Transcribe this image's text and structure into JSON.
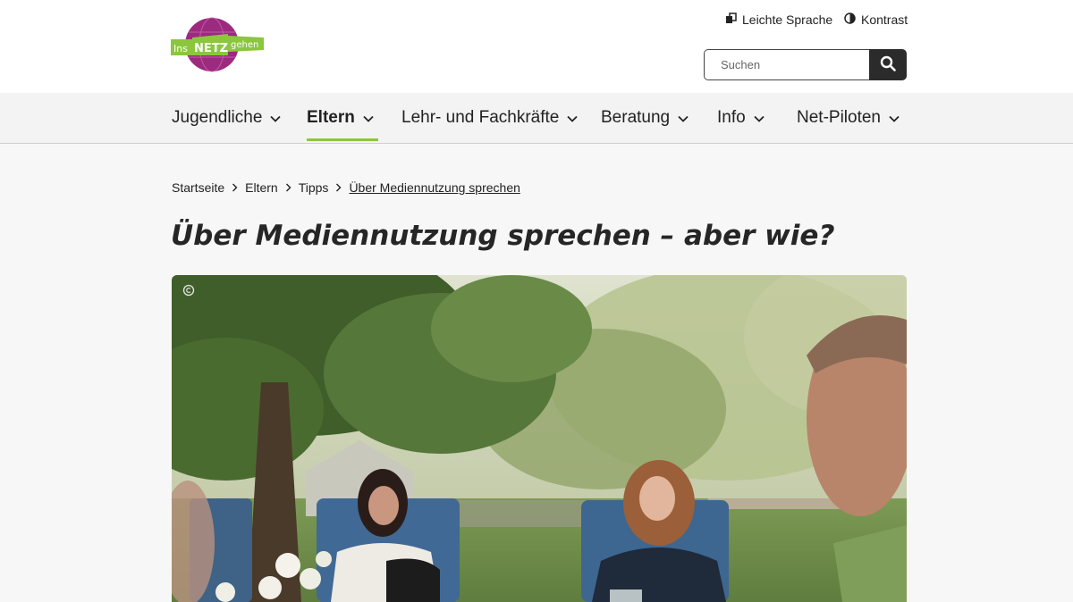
{
  "header": {
    "logo": {
      "text_left": "Ins",
      "text_center": "NETZ",
      "text_right": "gehen"
    },
    "utility": {
      "leichte_sprache": "Leichte Sprache",
      "kontrast": "Kontrast"
    },
    "search": {
      "placeholder": "Suchen",
      "value": ""
    }
  },
  "nav": {
    "items": [
      {
        "label": "Jugendliche",
        "active": false
      },
      {
        "label": "Eltern",
        "active": true
      },
      {
        "label": "Lehr- und Fachkräfte",
        "active": false
      },
      {
        "label": "Beratung",
        "active": false
      },
      {
        "label": "Info",
        "active": false
      },
      {
        "label": "Net-Piloten",
        "active": false
      }
    ]
  },
  "breadcrumb": {
    "items": [
      "Startseite",
      "Eltern",
      "Tipps",
      "Über Mediennutzung sprechen"
    ]
  },
  "page": {
    "title": "Über Mediennutzung sprechen – aber wie?"
  },
  "colors": {
    "accent_green": "#8cc63f",
    "logo_purple": "#9c2a7e",
    "search_button": "#2b2b2b",
    "title_text": "#262626"
  },
  "icons": {
    "leichte_sprache": "easy-language-icon",
    "kontrast": "contrast-icon",
    "search": "search-icon",
    "dropdown": "chevron-down-icon",
    "breadcrumb_sep": "chevron-right-icon",
    "copyright": "copyright-icon"
  }
}
